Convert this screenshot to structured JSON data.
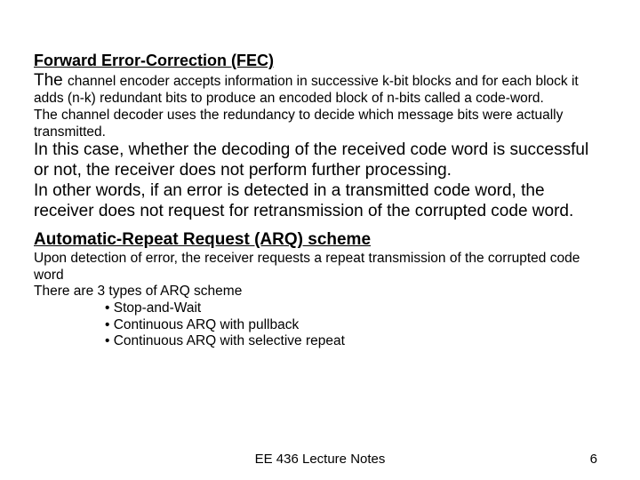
{
  "h1": "Forward Error-Correction (FEC)",
  "p1_lead": "The ",
  "p1_rest": "channel encoder accepts information in successive k-bit blocks and for each block it adds (n-k) redundant bits to produce an encoded block of n-bits called a code-word.",
  "p2": "The channel decoder uses the redundancy to decide which message bits were actually transmitted.",
  "p3": "In this case, whether the decoding of the received code word is successful or not, the receiver does not perform further processing.",
  "p4": "In other words, if an error is detected in a transmitted code word, the receiver does not request for retransmission of the corrupted code word.",
  "h2": "Automatic-Repeat Request (ARQ) scheme",
  "p5": "Upon detection of error, the receiver requests a repeat transmission of the corrupted code word",
  "p6": "There are 3 types of ARQ scheme",
  "b1": "• Stop-and-Wait",
  "b2": "• Continuous ARQ with pullback",
  "b3": "• Continuous ARQ with selective repeat",
  "footer_center": "EE 436 Lecture Notes",
  "footer_page": "6"
}
